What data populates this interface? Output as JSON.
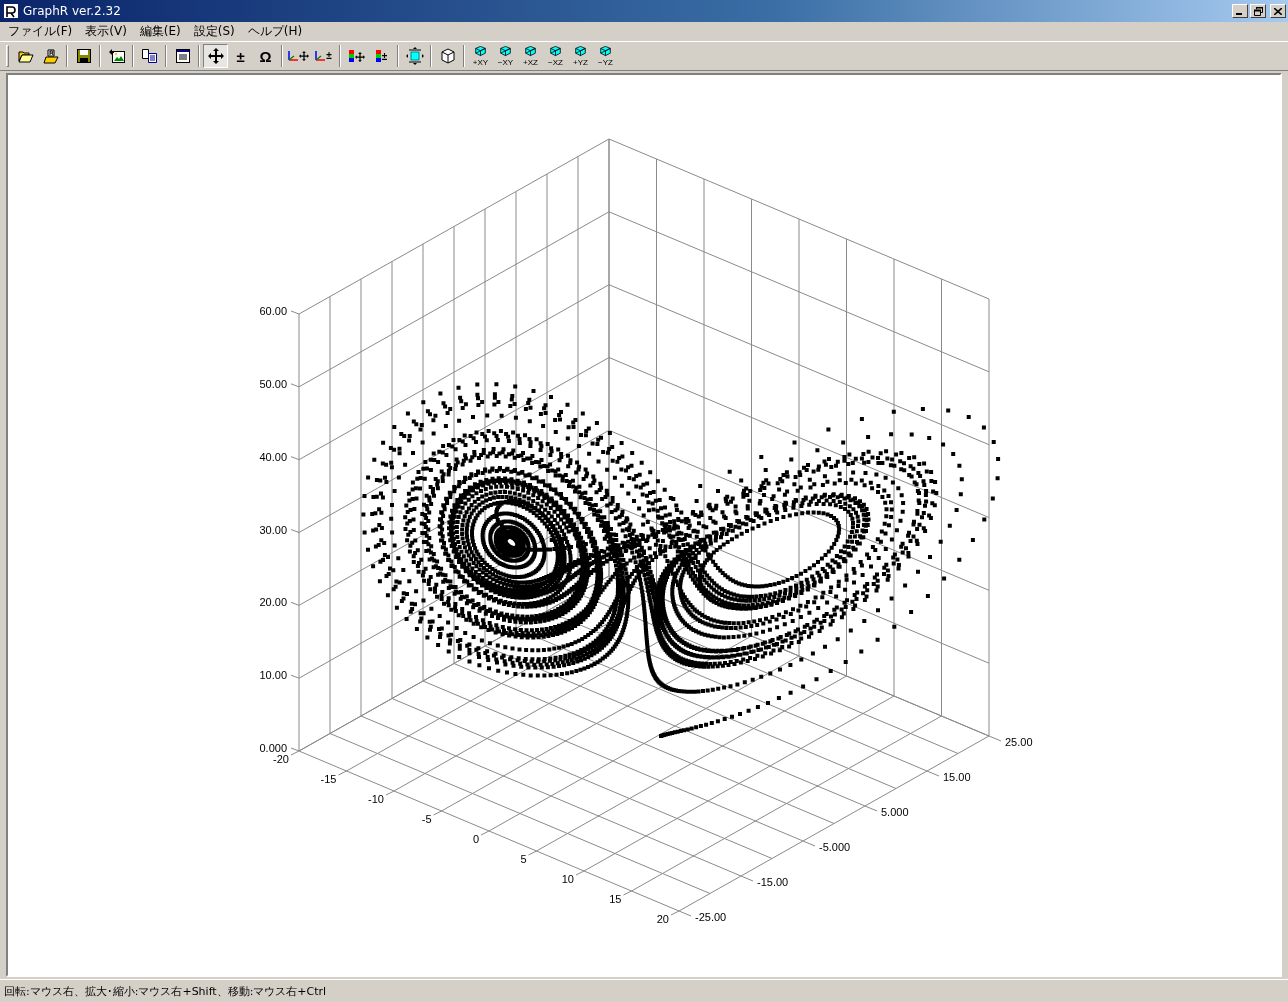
{
  "window": {
    "title": "GraphR ver.2.32"
  },
  "menu": [
    {
      "label": "ファイル(F)"
    },
    {
      "label": "表示(V)"
    },
    {
      "label": "編集(E)"
    },
    {
      "label": "設定(S)"
    },
    {
      "label": "ヘルプ(H)"
    }
  ],
  "toolbar": [
    [
      {
        "kind": "open-folder",
        "pressed": false
      },
      {
        "kind": "open-file",
        "pressed": false
      }
    ],
    [
      {
        "kind": "save",
        "pressed": false
      }
    ],
    [
      {
        "kind": "image",
        "pressed": false
      }
    ],
    [
      {
        "kind": "copy",
        "pressed": false
      }
    ],
    [
      {
        "kind": "document",
        "pressed": false
      }
    ],
    [
      {
        "kind": "move",
        "pressed": true
      },
      {
        "kind": "glyph",
        "glyph": "±",
        "pressed": false
      },
      {
        "kind": "glyph",
        "glyph": "Ω",
        "pressed": false
      }
    ],
    [
      {
        "kind": "axes-move",
        "pressed": false
      },
      {
        "kind": "axes-glyph",
        "glyph": "±",
        "pressed": false
      }
    ],
    [
      {
        "kind": "bar-move",
        "pressed": false
      },
      {
        "kind": "bar-glyph",
        "glyph": "±",
        "pressed": false
      }
    ],
    [
      {
        "kind": "fit",
        "pressed": false
      }
    ],
    [
      {
        "kind": "cube",
        "pressed": false
      }
    ],
    [
      {
        "kind": "view-cube",
        "label": "+XY",
        "pressed": false
      },
      {
        "kind": "view-cube",
        "label": "−XY",
        "pressed": false
      },
      {
        "kind": "view-cube",
        "label": "+XZ",
        "pressed": false
      },
      {
        "kind": "view-cube",
        "label": "−XZ",
        "pressed": false
      },
      {
        "kind": "view-cube",
        "label": "+YZ",
        "pressed": false
      },
      {
        "kind": "view-cube",
        "label": "−YZ",
        "pressed": false
      }
    ]
  ],
  "plot": {
    "z_axis": {
      "labels": [
        "60.00",
        "50.00",
        "40.00",
        "30.00",
        "20.00",
        "10.00",
        "0.000"
      ]
    },
    "x_axis": {
      "labels": [
        "-20",
        "-15",
        "-10",
        "-5",
        "0",
        "5",
        "10",
        "15",
        "20"
      ]
    },
    "y_axis": {
      "labels": [
        "25.00",
        "15.00",
        "5.000",
        "-5.000",
        "-15.00",
        "-25.00"
      ]
    }
  },
  "status_bar": {
    "text": "回転:マウス右、拡大･縮小:マウス右+Shift、移動:マウス右+Ctrl"
  }
}
